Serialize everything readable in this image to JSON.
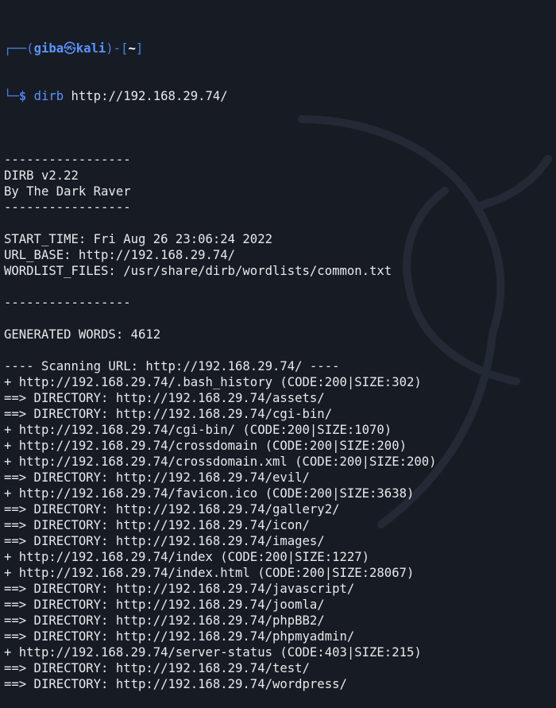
{
  "prompt": {
    "frame_top": "┌──(",
    "user": "giba",
    "symbol": "㉿",
    "host": "kali",
    "frame_mid": ")-[",
    "cwd": "~",
    "frame_end": "]",
    "frame_bottom": "└─",
    "dollar": "$",
    "command": "dirb",
    "argument": " http://192.168.29.74/"
  },
  "output_lines": [
    "",
    "-----------------",
    "DIRB v2.22",
    "By The Dark Raver",
    "-----------------",
    "",
    "START_TIME: Fri Aug 26 23:06:24 2022",
    "URL_BASE: http://192.168.29.74/",
    "WORDLIST_FILES: /usr/share/dirb/wordlists/common.txt",
    "",
    "-----------------",
    "",
    "GENERATED WORDS: 4612",
    "",
    "---- Scanning URL: http://192.168.29.74/ ----",
    "+ http://192.168.29.74/.bash_history (CODE:200|SIZE:302)",
    "==> DIRECTORY: http://192.168.29.74/assets/",
    "==> DIRECTORY: http://192.168.29.74/cgi-bin/",
    "+ http://192.168.29.74/cgi-bin/ (CODE:200|SIZE:1070)",
    "+ http://192.168.29.74/crossdomain (CODE:200|SIZE:200)",
    "+ http://192.168.29.74/crossdomain.xml (CODE:200|SIZE:200)",
    "==> DIRECTORY: http://192.168.29.74/evil/",
    "+ http://192.168.29.74/favicon.ico (CODE:200|SIZE:3638)",
    "==> DIRECTORY: http://192.168.29.74/gallery2/",
    "==> DIRECTORY: http://192.168.29.74/icon/",
    "==> DIRECTORY: http://192.168.29.74/images/",
    "+ http://192.168.29.74/index (CODE:200|SIZE:1227)",
    "+ http://192.168.29.74/index.html (CODE:200|SIZE:28067)",
    "==> DIRECTORY: http://192.168.29.74/javascript/",
    "==> DIRECTORY: http://192.168.29.74/joomla/",
    "==> DIRECTORY: http://192.168.29.74/phpBB2/",
    "==> DIRECTORY: http://192.168.29.74/phpmyadmin/",
    "+ http://192.168.29.74/server-status (CODE:403|SIZE:215)",
    "==> DIRECTORY: http://192.168.29.74/test/",
    "==> DIRECTORY: http://192.168.29.74/wordpress/"
  ]
}
